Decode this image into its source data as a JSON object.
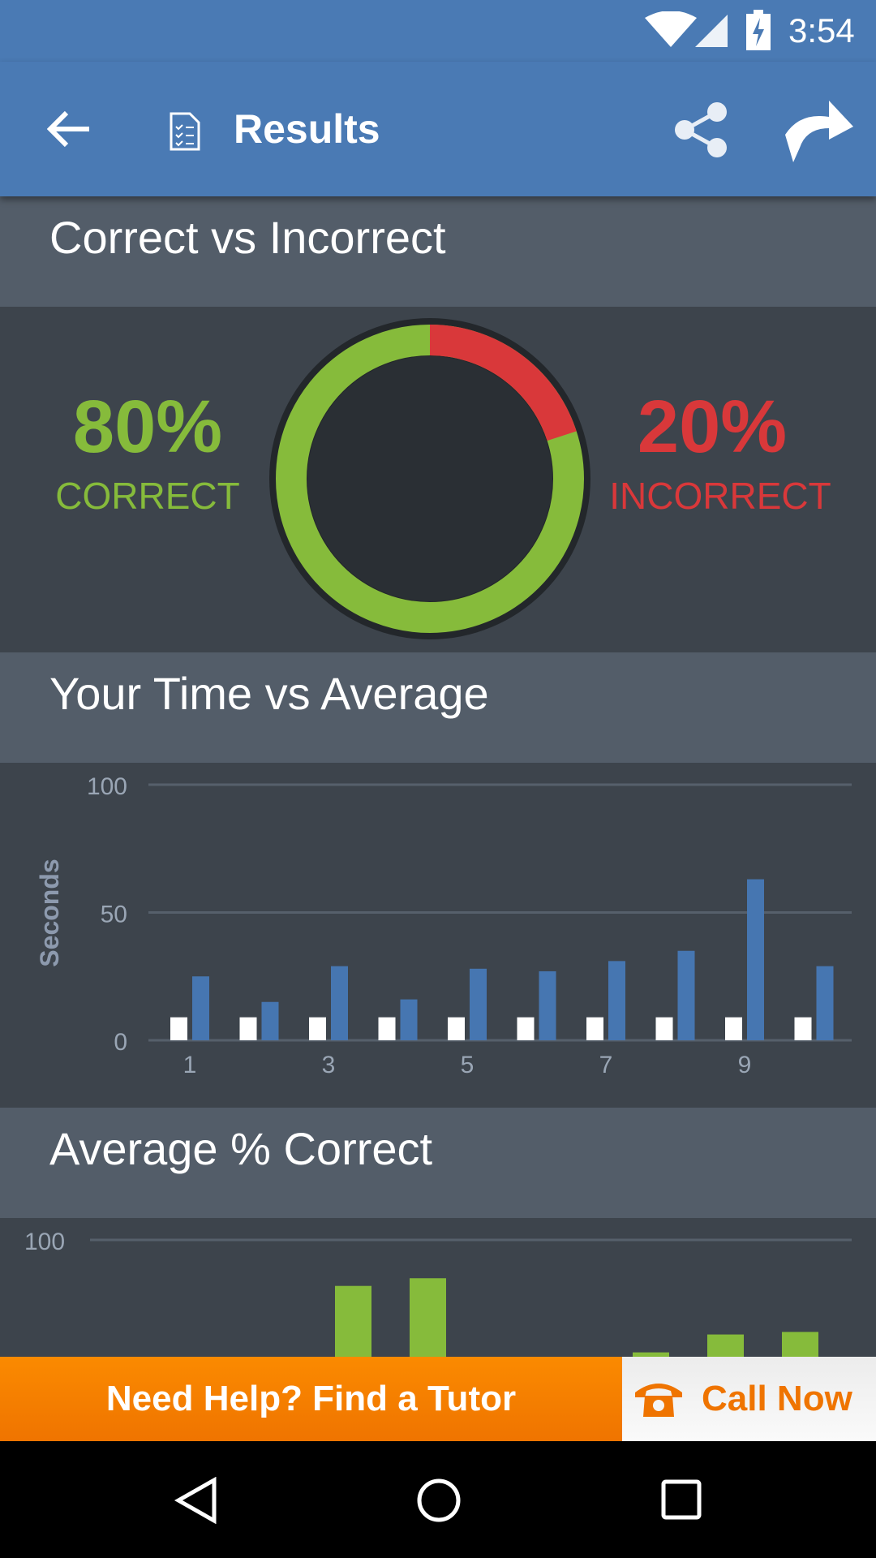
{
  "status_bar": {
    "time": "3:54",
    "icons": [
      "wifi-icon",
      "signal-icon",
      "battery-charging-icon"
    ]
  },
  "app_bar": {
    "title": "Results",
    "icons": [
      "back-arrow-icon",
      "document-checklist-icon",
      "share-icon",
      "forward-arrow-icon"
    ]
  },
  "colors": {
    "primary": "#4a7ab4",
    "correct": "#86bb3b",
    "incorrect": "#d9383a",
    "avg_bar": "#ffffff",
    "time_bar": "#4676b1",
    "banner": "#f98400"
  },
  "sections": {
    "correct_vs_incorrect": {
      "title": "Correct vs Incorrect",
      "correct_pct": "80%",
      "correct_label": "CORRECT",
      "incorrect_pct": "20%",
      "incorrect_label": "INCORRECT",
      "correct_fraction": 0.8
    },
    "time_vs_average": {
      "title": "Your Time vs Average"
    },
    "average_correct": {
      "title": "Average % Correct"
    }
  },
  "chart_data": [
    {
      "type": "bar",
      "ylabel": "Seconds",
      "ylim": [
        0,
        100
      ],
      "yticks": [
        "0",
        "50",
        "100"
      ],
      "xticks": [
        "1",
        "3",
        "5",
        "7",
        "9"
      ],
      "grid": true,
      "categories": [
        1,
        2,
        3,
        4,
        5,
        6,
        7,
        8,
        9,
        10
      ],
      "series": [
        {
          "values": [
            9,
            9,
            9,
            9,
            9,
            9,
            9,
            9,
            9,
            9
          ],
          "color": "#ffffff"
        },
        {
          "values": [
            25,
            15,
            29,
            16,
            28,
            27,
            31,
            35,
            63,
            29
          ],
          "color": "#4676b1"
        }
      ]
    },
    {
      "type": "bar",
      "ylim": [
        0,
        100
      ],
      "yticks": [
        "100"
      ],
      "grid": true,
      "categories": [
        1,
        2,
        3,
        4,
        5,
        6,
        7,
        8,
        9,
        10
      ],
      "series": [
        {
          "values": [
            null,
            null,
            null,
            82,
            85,
            null,
            null,
            56,
            63,
            64
          ],
          "color": "#86bb3b"
        }
      ]
    }
  ],
  "banner": {
    "tutor_label": "Need Help? Find a Tutor",
    "call_label": "Call Now"
  },
  "nav_bar": {
    "icons": [
      "back-triangle-icon",
      "home-circle-icon",
      "recents-square-icon"
    ]
  }
}
